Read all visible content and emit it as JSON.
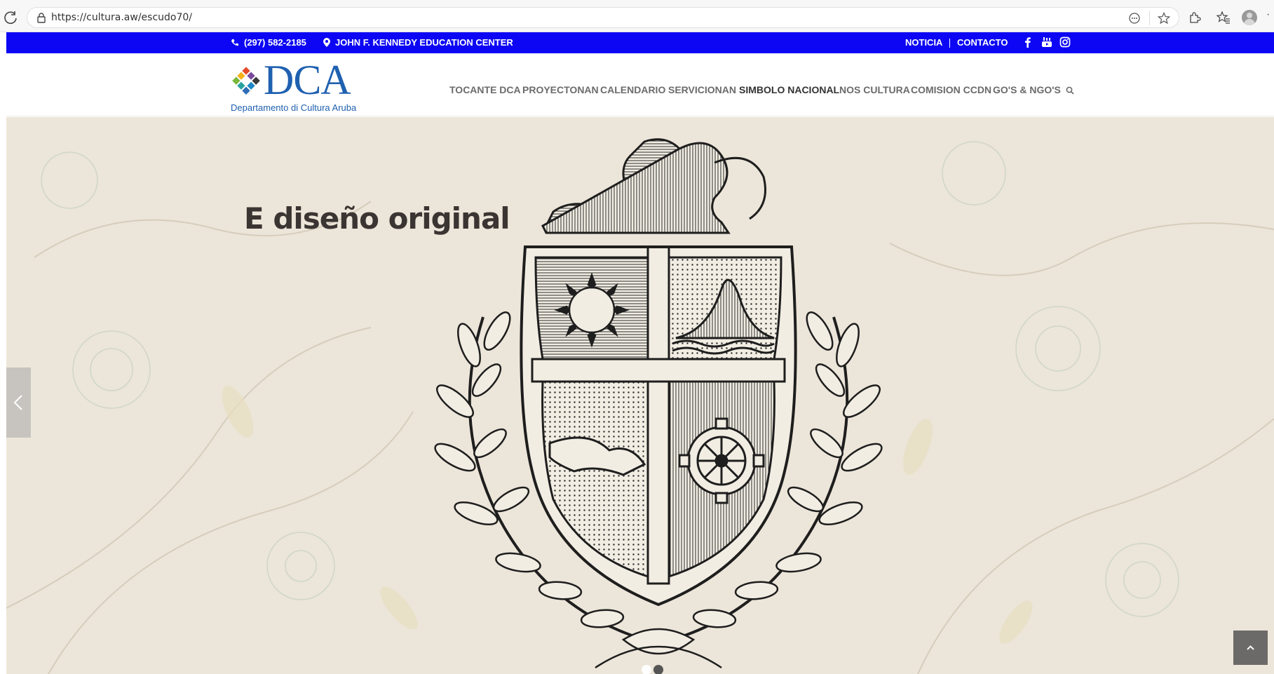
{
  "browser": {
    "url": "https://cultura.aw/escudo70/",
    "icons": [
      "reload-icon",
      "lock-icon",
      "reader-icon",
      "favorite-icon",
      "extensions-icon",
      "favorites-icon",
      "profile-icon",
      "more-icon"
    ]
  },
  "topbar": {
    "phone": "(297) 582-2185",
    "location": "JOHN F. KENNEDY EDUCATION CENTER",
    "links": [
      "NOTICIA",
      "CONTACTO"
    ],
    "social": [
      "facebook-icon",
      "youtube-icon",
      "instagram-icon"
    ],
    "background_color": "#0c06f4"
  },
  "header": {
    "logo_text": "DCA",
    "logo_subtitle": "Departamento di Cultura Aruba",
    "logo_color": "#1f60b0",
    "nav": [
      "TOCANTE DCA",
      "PROYECTONAN",
      "CALENDARIO",
      "SERVICIONAN",
      "SIMBOLO NACIONAL",
      "NOS CULTURA",
      "COMISION CCDN",
      "GO'S & NGO'S"
    ],
    "active_nav": "SIMBOLO NACIONAL"
  },
  "hero": {
    "title": "E diseño original",
    "slides_total": 2,
    "active_slide": 2
  }
}
